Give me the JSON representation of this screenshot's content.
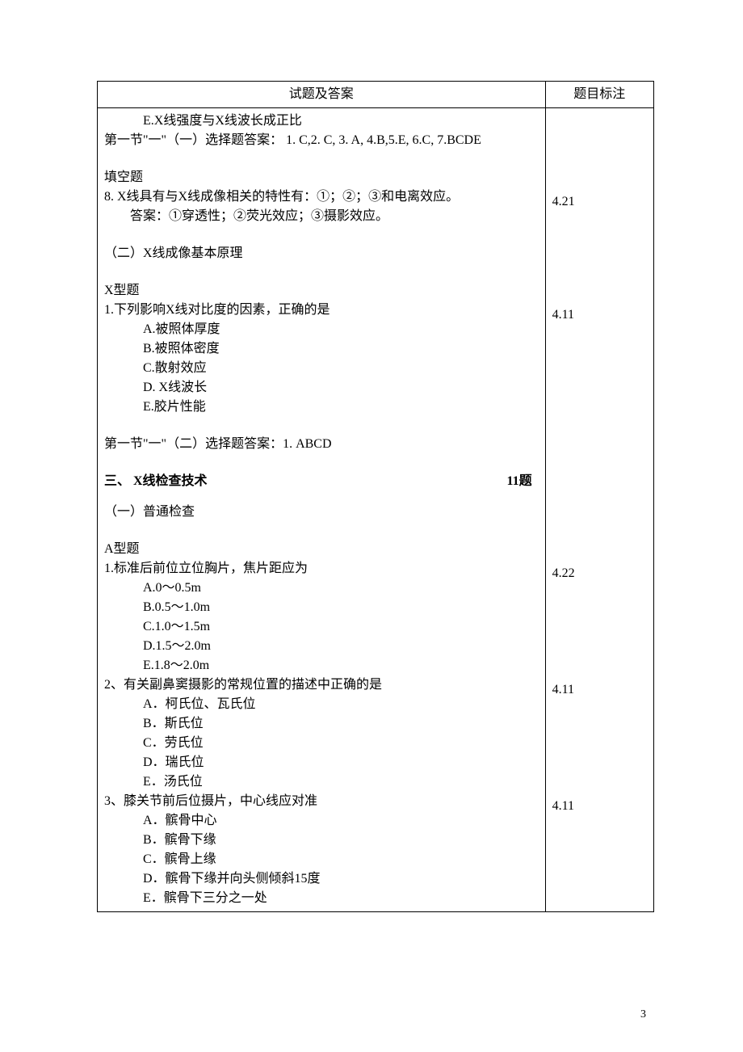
{
  "header": {
    "col_main": "试题及答案",
    "col_note": "题目标注"
  },
  "top": {
    "e_line": "E.X线强度与X线波长成正比",
    "ans1": "第一节\"一\"（一）选择题答案： 1. C,2. C, 3. A, 4.B,5.E, 6.C, 7.BCDE"
  },
  "fill": {
    "title": "填空题",
    "q8_stem": "8. X线具有与X线成像相关的特性有：①；②；③和电离效应。",
    "q8_ans": "答案：①穿透性；②荧光效应；③摄影效应。",
    "note": "4.21"
  },
  "sub2": {
    "title": "（二）X线成像基本原理"
  },
  "xq": {
    "title": "X型题",
    "q1": {
      "stem": "1.下列影响X线对比度的因素，正确的是",
      "opts": [
        "A.被照体厚度",
        "B.被照体密度",
        "C.散射效应",
        "D. X线波长",
        "E.胶片性能"
      ],
      "note": "4.11"
    },
    "ans": "第一节\"一\"（二）选择题答案：1. ABCD"
  },
  "sec3": {
    "title": "三、 X线检查技术",
    "count": "11题",
    "sub1": "（一）普通检查"
  },
  "aq": {
    "title": "A型题",
    "q1": {
      "stem": "1.标准后前位立位胸片，焦片距应为",
      "opts": [
        "A.0～0.5m",
        "B.0.5～1.0m",
        "C.1.0～1.5m",
        "D.1.5～2.0m",
        "E.1.8～2.0m"
      ],
      "note": "4.22"
    },
    "q2": {
      "stem": "2、有关副鼻窦摄影的常规位置的描述中正确的是",
      "opts": [
        "A．柯氏位、瓦氏位",
        "B．斯氏位",
        "C．劳氏位",
        "D．瑞氏位",
        "E．汤氏位"
      ],
      "note": "4.11"
    },
    "q3": {
      "stem": "3、膝关节前后位摄片，中心线应对准",
      "opts": [
        "A．髌骨中心",
        "B．髌骨下缘",
        "C．髌骨上缘",
        "D．髌骨下缘并向头侧倾斜15度",
        "E．髌骨下三分之一处"
      ],
      "note": "4.11"
    }
  },
  "page_number": "3"
}
